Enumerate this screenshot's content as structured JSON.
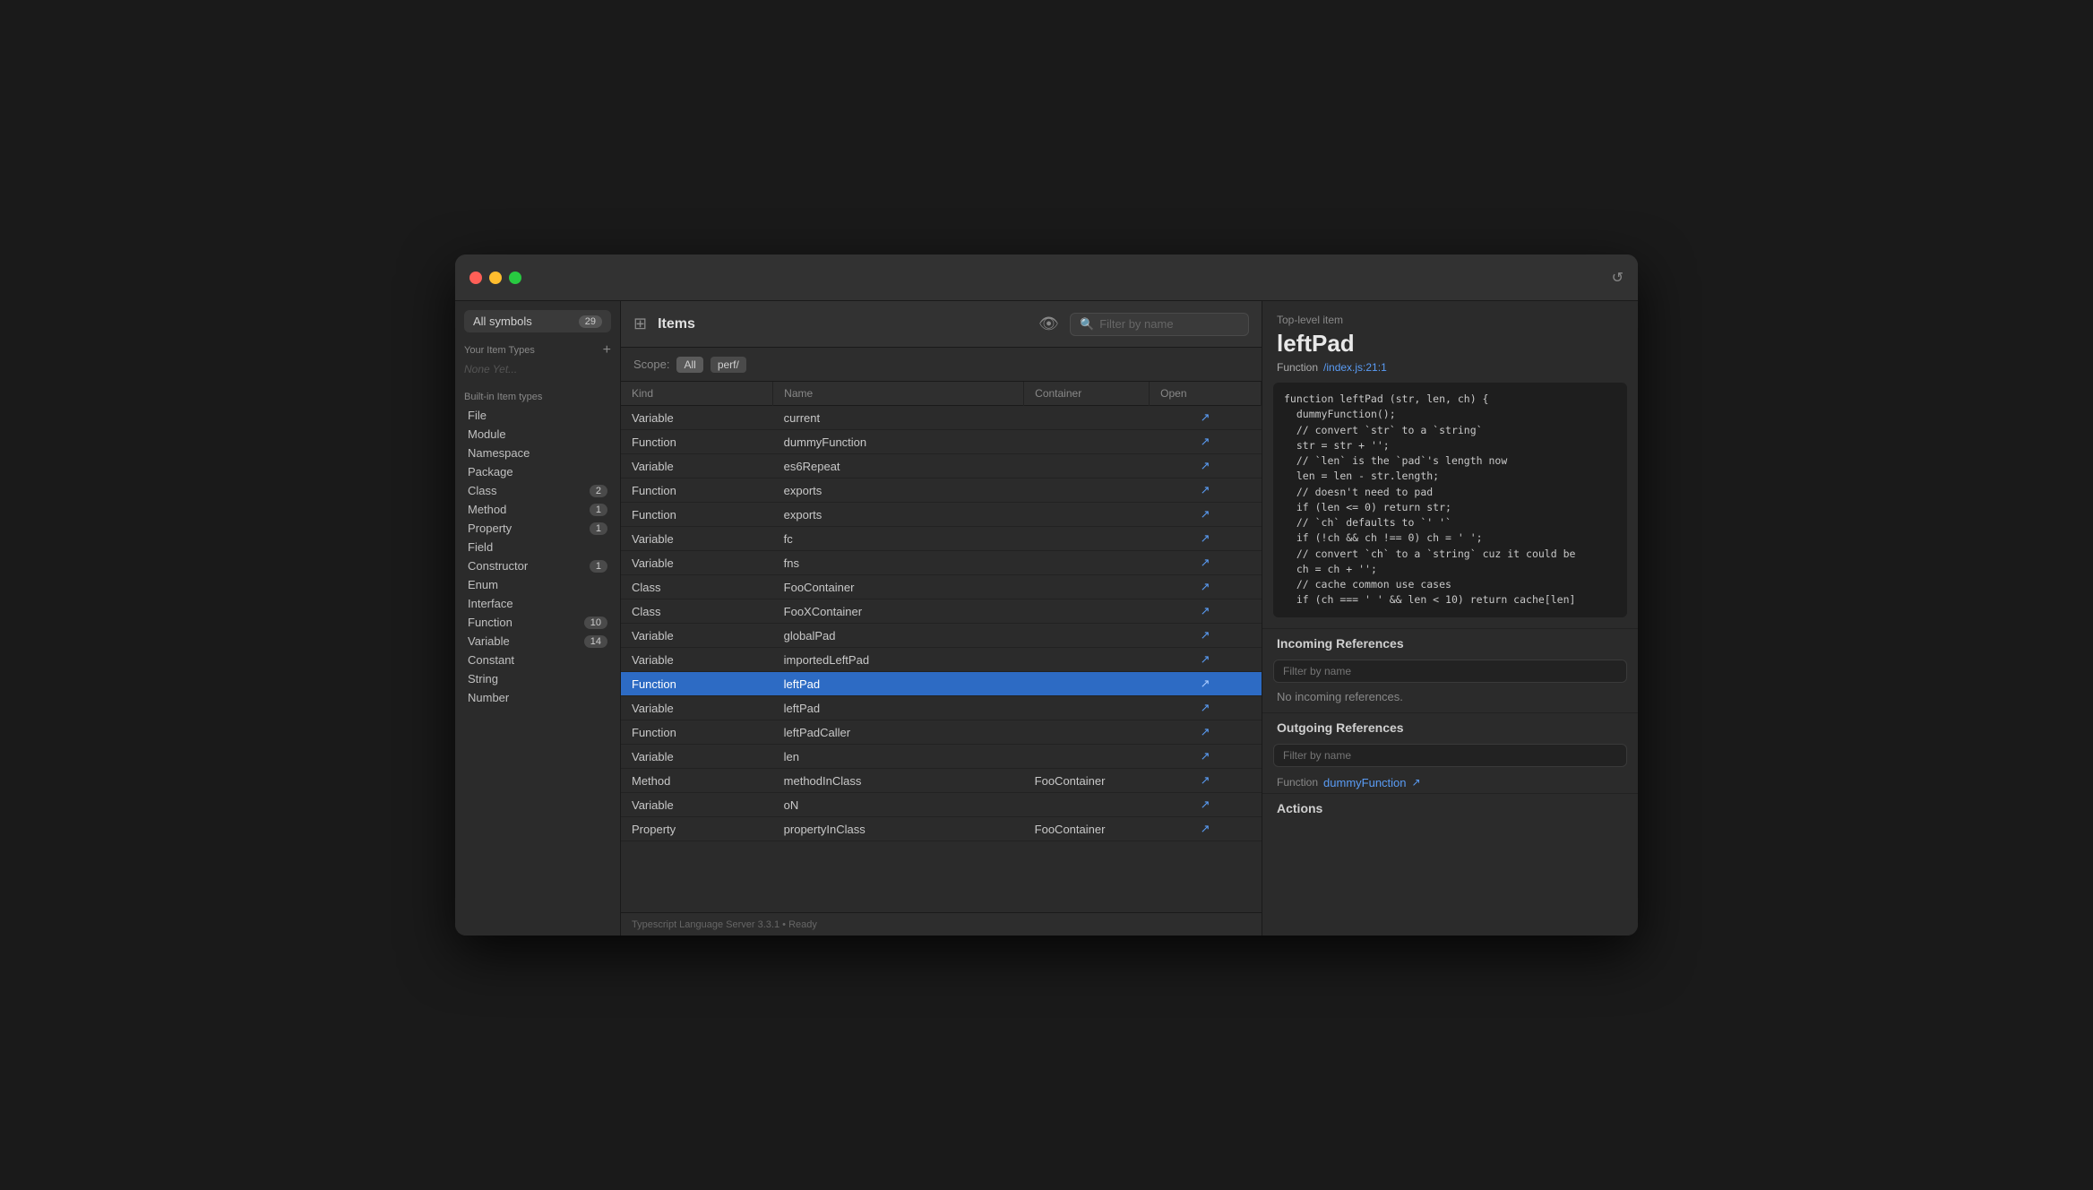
{
  "window": {
    "title": "Items"
  },
  "sidebar": {
    "all_symbols_label": "All symbols",
    "all_symbols_count": "29",
    "your_item_types_label": "Your Item Types",
    "none_yet_label": "None Yet...",
    "built_in_label": "Built-in Item types",
    "items": [
      {
        "name": "File",
        "count": null
      },
      {
        "name": "Module",
        "count": null
      },
      {
        "name": "Namespace",
        "count": null
      },
      {
        "name": "Package",
        "count": null
      },
      {
        "name": "Class",
        "count": "2"
      },
      {
        "name": "Method",
        "count": "1"
      },
      {
        "name": "Property",
        "count": "1"
      },
      {
        "name": "Field",
        "count": null
      },
      {
        "name": "Constructor",
        "count": "1"
      },
      {
        "name": "Enum",
        "count": null
      },
      {
        "name": "Interface",
        "count": null
      },
      {
        "name": "Function",
        "count": "10"
      },
      {
        "name": "Variable",
        "count": "14"
      },
      {
        "name": "Constant",
        "count": null
      },
      {
        "name": "String",
        "count": null
      },
      {
        "name": "Number",
        "count": null
      }
    ]
  },
  "toolbar": {
    "title": "Items",
    "search_placeholder": "Filter by name"
  },
  "scope": {
    "label": "Scope:",
    "all": "All",
    "perf": "perf/"
  },
  "table": {
    "columns": [
      "Kind",
      "Name",
      "Container",
      "Open"
    ],
    "rows": [
      {
        "kind": "Variable",
        "name": "current",
        "container": "",
        "open": true,
        "selected": false
      },
      {
        "kind": "Function",
        "name": "dummyFunction",
        "container": "",
        "open": true,
        "selected": false
      },
      {
        "kind": "Variable",
        "name": "es6Repeat",
        "container": "",
        "open": true,
        "selected": false
      },
      {
        "kind": "Function",
        "name": "exports",
        "container": "",
        "open": true,
        "selected": false
      },
      {
        "kind": "Function",
        "name": "exports",
        "container": "",
        "open": true,
        "selected": false
      },
      {
        "kind": "Variable",
        "name": "fc",
        "container": "",
        "open": true,
        "selected": false
      },
      {
        "kind": "Variable",
        "name": "fns",
        "container": "",
        "open": true,
        "selected": false
      },
      {
        "kind": "Class",
        "name": "FooContainer",
        "container": "",
        "open": true,
        "selected": false
      },
      {
        "kind": "Class",
        "name": "FooXContainer",
        "container": "",
        "open": true,
        "selected": false
      },
      {
        "kind": "Variable",
        "name": "globalPad",
        "container": "",
        "open": true,
        "selected": false
      },
      {
        "kind": "Variable",
        "name": "importedLeftPad",
        "container": "",
        "open": true,
        "selected": false
      },
      {
        "kind": "Function",
        "name": "leftPad",
        "container": "",
        "open": true,
        "selected": true
      },
      {
        "kind": "Variable",
        "name": "leftPad",
        "container": "",
        "open": true,
        "selected": false
      },
      {
        "kind": "Function",
        "name": "leftPadCaller",
        "container": "",
        "open": true,
        "selected": false
      },
      {
        "kind": "Variable",
        "name": "len",
        "container": "",
        "open": true,
        "selected": false
      },
      {
        "kind": "Method",
        "name": "methodInClass",
        "container": "FooContainer",
        "open": true,
        "selected": false
      },
      {
        "kind": "Variable",
        "name": "oN",
        "container": "",
        "open": true,
        "selected": false
      },
      {
        "kind": "Property",
        "name": "propertyInClass",
        "container": "FooContainer",
        "open": true,
        "selected": false
      }
    ]
  },
  "status_bar": {
    "text": "Typescript Language Server 3.3.1 • Ready"
  },
  "detail": {
    "top_label": "Top-level item",
    "item_name": "leftPad",
    "kind": "Function",
    "location": "/index.js:21:1",
    "code": "function leftPad (str, len, ch) {\n  dummyFunction();\n  // convert `str` to a `string`\n  str = str + '';\n  // `len` is the `pad`'s length now\n  len = len - str.length;\n  // doesn't need to pad\n  if (len <= 0) return str;\n  // `ch` defaults to `' '`\n  if (!ch && ch !== 0) ch = ' ';\n  // convert `ch` to a `string` cuz it could be\n  ch = ch + '';\n  // cache common use cases\n  if (ch === ' ' && len < 10) return cache[len]",
    "incoming_refs_label": "Incoming References",
    "incoming_filter_placeholder": "Filter by name",
    "no_incoming": "No incoming references.",
    "outgoing_refs_label": "Outgoing References",
    "outgoing_filter_placeholder": "Filter by name",
    "outgoing_ref_kind": "Function",
    "outgoing_ref_name": "dummyFunction",
    "actions_label": "Actions"
  }
}
